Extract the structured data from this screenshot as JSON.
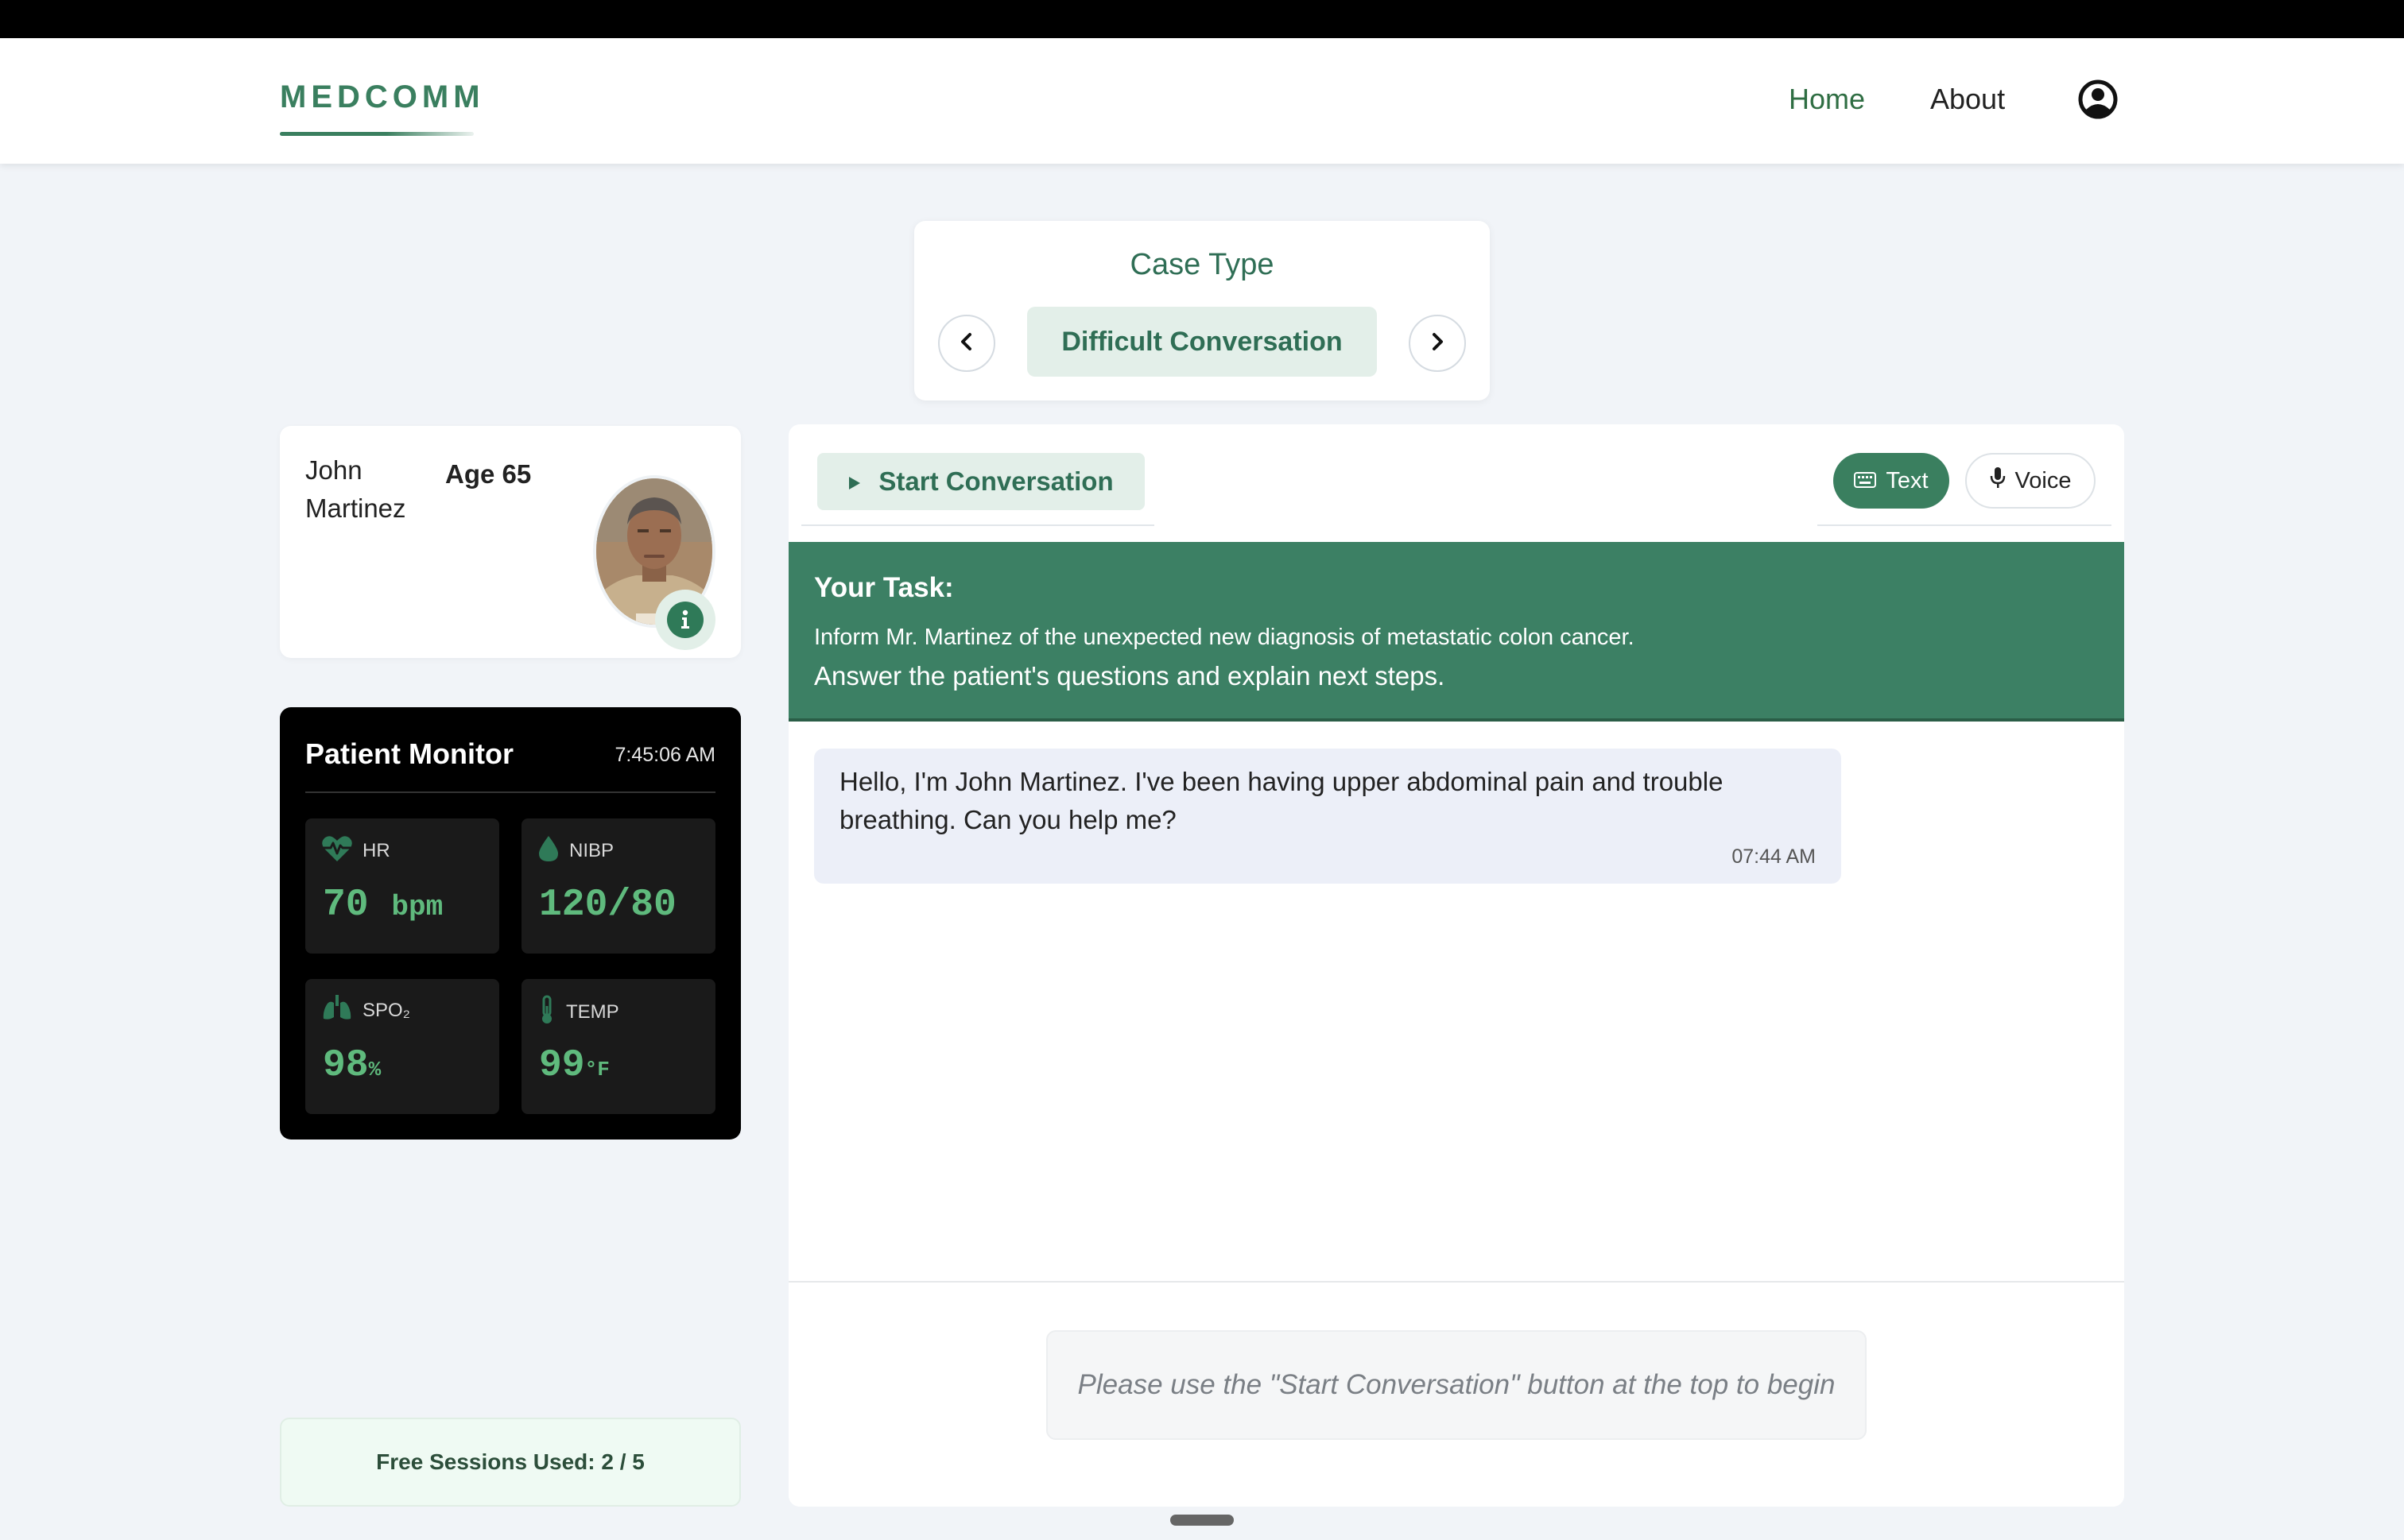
{
  "header": {
    "logo": "MEDCOMM",
    "nav": {
      "home": "Home",
      "about": "About"
    },
    "colors": {
      "brand": "#3a7f5f",
      "nav_active": "#2f6e43"
    }
  },
  "case_selector": {
    "title": "Case Type",
    "selected": "Difficult Conversation"
  },
  "patient": {
    "name": "John Martinez",
    "age_label": "Age 65"
  },
  "monitor": {
    "title": "Patient Monitor",
    "time": "7:45:06 AM",
    "vitals": {
      "hr": {
        "label": "HR",
        "value": "70",
        "unit": "bpm",
        "icon": "heart-pulse-icon"
      },
      "nibp": {
        "label": "NIBP",
        "value": "120/80",
        "icon": "droplet-icon"
      },
      "spo2": {
        "label": "SPO₂",
        "value": "98",
        "unit": "%",
        "icon": "lungs-icon"
      },
      "temp": {
        "label": "TEMP",
        "value": "99",
        "unit": "°F",
        "icon": "thermometer-icon"
      }
    },
    "colors": {
      "value": "#5fba7d"
    }
  },
  "sessions": {
    "text": "Free Sessions Used: 2 / 5"
  },
  "chat": {
    "start_button": "Start Conversation",
    "modes": {
      "text": "Text",
      "voice": "Voice",
      "active": "Text"
    },
    "task": {
      "heading": "Your Task:",
      "line1": "Inform Mr. Martinez of the unexpected new diagnosis of metastatic colon cancer.",
      "line2": "Answer the patient's questions and explain next steps."
    },
    "messages": [
      {
        "text": "Hello, I'm John Martinez. I've been having upper abdominal pain and trouble breathing. Can you help me?",
        "time": "07:44 AM"
      }
    ],
    "input_hint": "Please use the \"Start Conversation\" button at the top to begin"
  }
}
